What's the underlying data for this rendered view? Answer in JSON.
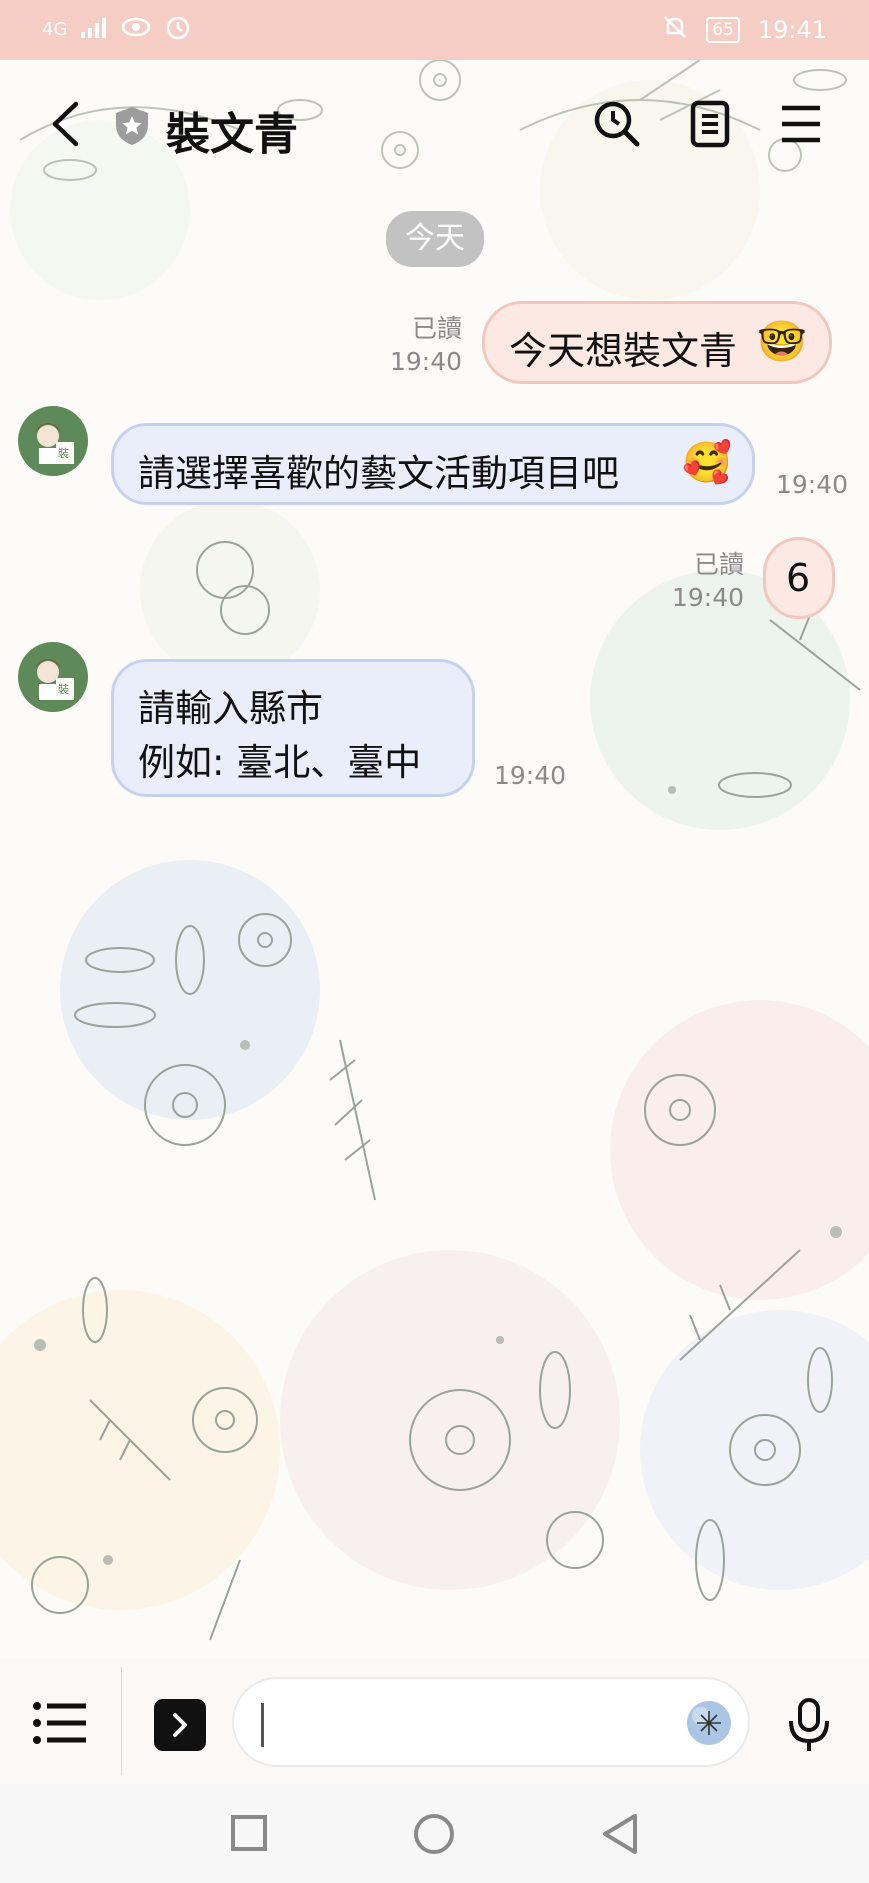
{
  "status_bar": {
    "network": "4G",
    "battery": "65",
    "time": "19:41"
  },
  "header": {
    "title": "裝文青"
  },
  "chat": {
    "date_chip": "今天",
    "messages": [
      {
        "direction": "out",
        "text": "今天想裝文青",
        "emoji": "🤓",
        "read_label": "已讀",
        "time": "19:40"
      },
      {
        "direction": "in",
        "text": "請選擇喜歡的藝文活動項目吧",
        "emoji": "🥰",
        "time": "19:40"
      },
      {
        "direction": "out",
        "text": "6",
        "read_label": "已讀",
        "time": "19:40"
      },
      {
        "direction": "in",
        "line1": "請輸入縣市",
        "line2": "例如: 臺北、臺中",
        "time": "19:40"
      }
    ]
  },
  "input": {
    "value": ""
  },
  "icons": {
    "back": "back-arrow-icon",
    "shield": "shield-star-icon",
    "search": "search-clock-icon",
    "notes": "notes-icon",
    "menu": "menu-icon",
    "keyboard_menu": "list-menu-icon",
    "expand": "expand-chevron-icon",
    "sticker": "sticker-icon",
    "mic": "microphone-icon"
  },
  "colors": {
    "status_bar": "#f6cdc4",
    "outgoing_bubble": "#fde9e4",
    "incoming_bubble": "#eaeefb",
    "date_chip": "#c2c2c2"
  }
}
